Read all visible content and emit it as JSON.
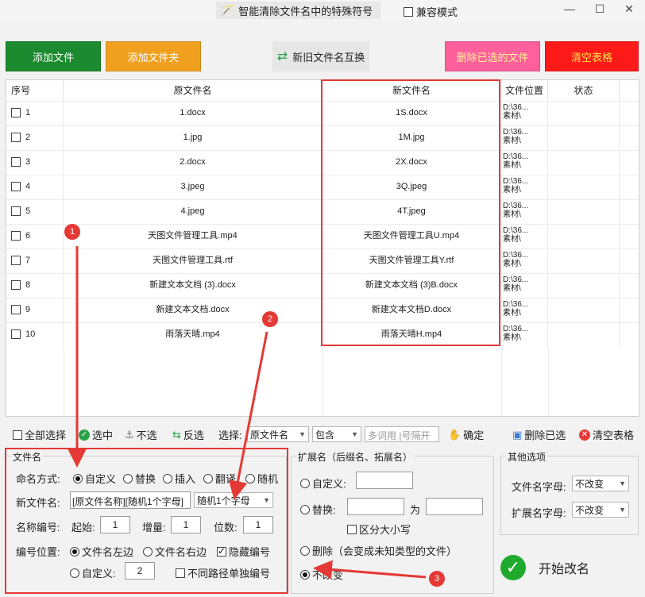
{
  "title": "智能清除文件名中的特殊符号",
  "compat_mode": "兼容模式",
  "toolbar": {
    "add_file": "添加文件",
    "add_folder": "添加文件夹",
    "swap": "新旧文件名互换",
    "delete_selected": "删除已选的文件",
    "clear_table": "清空表格"
  },
  "grid": {
    "headers": [
      "序号",
      "原文件名",
      "新文件名",
      "文件位置",
      "状态"
    ],
    "rows": [
      {
        "num": "1",
        "orig": "1.docx",
        "new": "1S.docx",
        "loc1": "D:\\36...",
        "loc2": "素材\\"
      },
      {
        "num": "2",
        "orig": "1.jpg",
        "new": "1M.jpg",
        "loc1": "D:\\36...",
        "loc2": "素材\\"
      },
      {
        "num": "3",
        "orig": "2.docx",
        "new": "2X.docx",
        "loc1": "D:\\36...",
        "loc2": "素材\\"
      },
      {
        "num": "4",
        "orig": "3.jpeg",
        "new": "3Q.jpeg",
        "loc1": "D:\\36...",
        "loc2": "素材\\"
      },
      {
        "num": "5",
        "orig": "4.jpeg",
        "new": "4T.jpeg",
        "loc1": "D:\\36...",
        "loc2": "素材\\"
      },
      {
        "num": "6",
        "orig": "天图文件管理工具.mp4",
        "new": "天图文件管理工具U.mp4",
        "loc1": "D:\\36...",
        "loc2": "素材\\"
      },
      {
        "num": "7",
        "orig": "天图文件管理工具.rtf",
        "new": "天图文件管理工具Y.rtf",
        "loc1": "D:\\36...",
        "loc2": "素材\\"
      },
      {
        "num": "8",
        "orig": "新建文本文档 (3).docx",
        "new": "新建文本文档 (3)B.docx",
        "loc1": "D:\\36...",
        "loc2": "素材\\"
      },
      {
        "num": "9",
        "orig": "新建文本文档.docx",
        "new": "新建文本文档D.docx",
        "loc1": "D:\\36...",
        "loc2": "素材\\"
      },
      {
        "num": "10",
        "orig": "雨落天晴.mp4",
        "new": "雨落天晴H.mp4",
        "loc1": "D:\\36...",
        "loc2": "素材\\"
      }
    ]
  },
  "selbar": {
    "select_all": "全部选择",
    "select": "选中",
    "unselect": "不选",
    "invert": "反选",
    "choose": "选择:",
    "field": "原文件名",
    "match": "包含",
    "placeholder": "多词用 |号隔开",
    "confirm": "确定",
    "delete_selected": "删除已选",
    "clear": "清空表格"
  },
  "filename": {
    "title": "文件名",
    "naming_label": "命名方式:",
    "modes": [
      "自定义",
      "替换",
      "插入",
      "翻译",
      "随机"
    ],
    "new_name_label": "新文件名:",
    "new_name_value": "[原文件名称][随机1个字母]",
    "new_name_combo": "随机1个字母",
    "numbering_label": "名称编号:",
    "start_label": "起始:",
    "start_value": "1",
    "step_label": "增量:",
    "step_value": "1",
    "digits_label": "位数:",
    "digits_value": "1",
    "position_label": "编号位置:",
    "pos_left": "文件名左边",
    "pos_right": "文件名右边",
    "hide_number": "隐藏编号",
    "custom": "自定义:",
    "custom_value": "2",
    "separate_path": "不同路径单独编号"
  },
  "ext": {
    "title": "扩展名（后缀名、拓展名）",
    "custom": "自定义:",
    "replace": "替换:",
    "to": "为",
    "case_sensitive": "区分大小写",
    "delete": "删除（会变成未知类型的文件）",
    "unchanged": "不改变"
  },
  "other": {
    "title": "其他选项",
    "filename_case_label": "文件名字母:",
    "filename_case_value": "不改变",
    "ext_case_label": "扩展名字母:",
    "ext_case_value": "不改变"
  },
  "start": "开始改名",
  "badges": [
    "1",
    "2",
    "3"
  ]
}
